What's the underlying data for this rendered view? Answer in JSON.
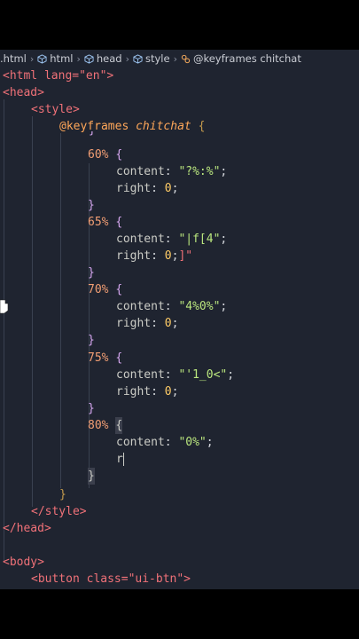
{
  "breadcrumb": {
    "items": [
      {
        "label": ".html",
        "icon": null
      },
      {
        "label": "html",
        "icon": "element-cube-icon"
      },
      {
        "label": "head",
        "icon": "element-cube-icon"
      },
      {
        "label": "style",
        "icon": "element-cube-icon"
      },
      {
        "label": "@keyframes chitchat",
        "icon": "keyframes-icon"
      }
    ]
  },
  "code": {
    "html_open": "<html lang=\"en\">",
    "head_open": "<head>",
    "style_open": "<style>",
    "keyframes_kw": "@keyframes",
    "keyframes_name": "chitchat",
    "keyframes_brace": "{",
    "partial_brace": "}",
    "k60_sel": "60%",
    "k60_content": "\"?%:%\"",
    "k65_sel": "65%",
    "k65_content": "\"|f[4\"",
    "k65_right_extra": "]\"",
    "k70_sel": "70%",
    "k70_content": "\"4%0%\"",
    "k75_sel": "75%",
    "k75_content": "\"'1_0<\"",
    "k80_sel": "80%",
    "k80_content": "\"0%\"",
    "typing": "r",
    "content_prop": "content",
    "right_prop": "right",
    "zero": "0",
    "style_close": "</style>",
    "head_close": "</head>",
    "body_open": "<body>",
    "button_line": "<button class=\"ui-btn\">"
  }
}
